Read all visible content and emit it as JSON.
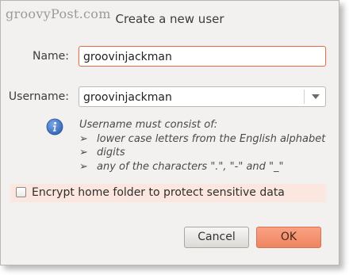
{
  "watermark": "groovyPost.com",
  "dialog": {
    "title": "Create a new user"
  },
  "name": {
    "label": "Name:",
    "value": "groovinjackman"
  },
  "username": {
    "label": "Username:",
    "value": "groovinjackman"
  },
  "hint": {
    "heading": "Username must consist of:",
    "bullet": "➢",
    "items": [
      "lower case letters from the English alphabet",
      "digits",
      "any of the characters \".\", \"-\" and \"_\""
    ]
  },
  "encrypt": {
    "label": "Encrypt home folder to protect sensitive data",
    "checked": false
  },
  "buttons": {
    "cancel": "Cancel",
    "ok": "OK"
  },
  "colors": {
    "accent": "#e2714a",
    "ok_button": "#f08a66",
    "info_icon": "#3a6fc0"
  }
}
